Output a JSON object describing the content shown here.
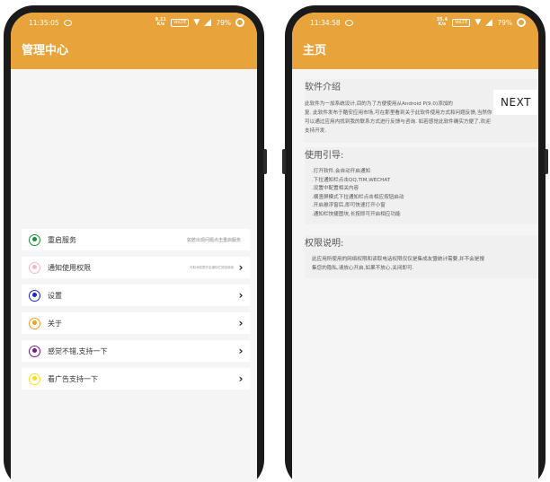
{
  "left_phone": {
    "status": {
      "time": "11:35:05",
      "speed_value": "9.11",
      "speed_unit": "K/s",
      "network": "VoLTE",
      "battery": "79%"
    },
    "app_title": "管理中心",
    "menu": [
      {
        "label": "重启服务",
        "hint": "如若出现问题点击重启服务",
        "has_chevron": false,
        "color": "#1e8c3a"
      },
      {
        "label": "通知使用权限",
        "hint": "可取消权限开启通知栏按钮使用",
        "has_chevron": true,
        "color": "#f5b8c6"
      },
      {
        "label": "设置",
        "hint": "",
        "has_chevron": true,
        "color": "#1a28c8"
      },
      {
        "label": "关于",
        "hint": "",
        "has_chevron": true,
        "color": "#f0a020"
      },
      {
        "label": "感觉不错,支持一下",
        "hint": "",
        "has_chevron": true,
        "color": "#7a1a8c"
      },
      {
        "label": "看广告支持一下",
        "hint": "",
        "has_chevron": true,
        "color": "#f5e020"
      }
    ]
  },
  "right_phone": {
    "status": {
      "time": "11:34:58",
      "speed_value": "35.4",
      "speed_unit": "K/s",
      "network": "VoLTE",
      "battery": "79%"
    },
    "app_title": "主页",
    "next_button": "NEXT",
    "intro": {
      "title": "软件介绍",
      "lines": [
        "    此软件为一加系统设计,目的为了方便使用从Android P(9.0)添加的",
        "复. 此软件发布于酷安应用市场,可在那里看到关于此软件使用方式和问题反馈,当然你",
        "可以通过应用内找到我的联系方式进行反馈与咨询. 如若感觉此软件确实方便了,欢迎",
        "支持开发."
      ]
    },
    "guide": {
      "title": "使用引导:",
      "lines": [
        ".打开软件,会自动开启通知",
        ".下拉通知栏点击QQ,TIM,WECHAT",
        ".设置中配置相关内容",
        ".横竖屏模式下拉通知栏点击相应按钮启动",
        ".开启悬浮窗后,即可快速打开小窗",
        ".通知栏快捷图块,长按即可开启相应功能"
      ]
    },
    "permission": {
      "title": "权限说明:",
      "lines": [
        "此应用所使用的网络权限和读取电话权限仅仅是集成友盟统计需要,并不会是搜",
        "集您的隐私,请放心开启,如果不放心,关闭即可."
      ]
    }
  }
}
